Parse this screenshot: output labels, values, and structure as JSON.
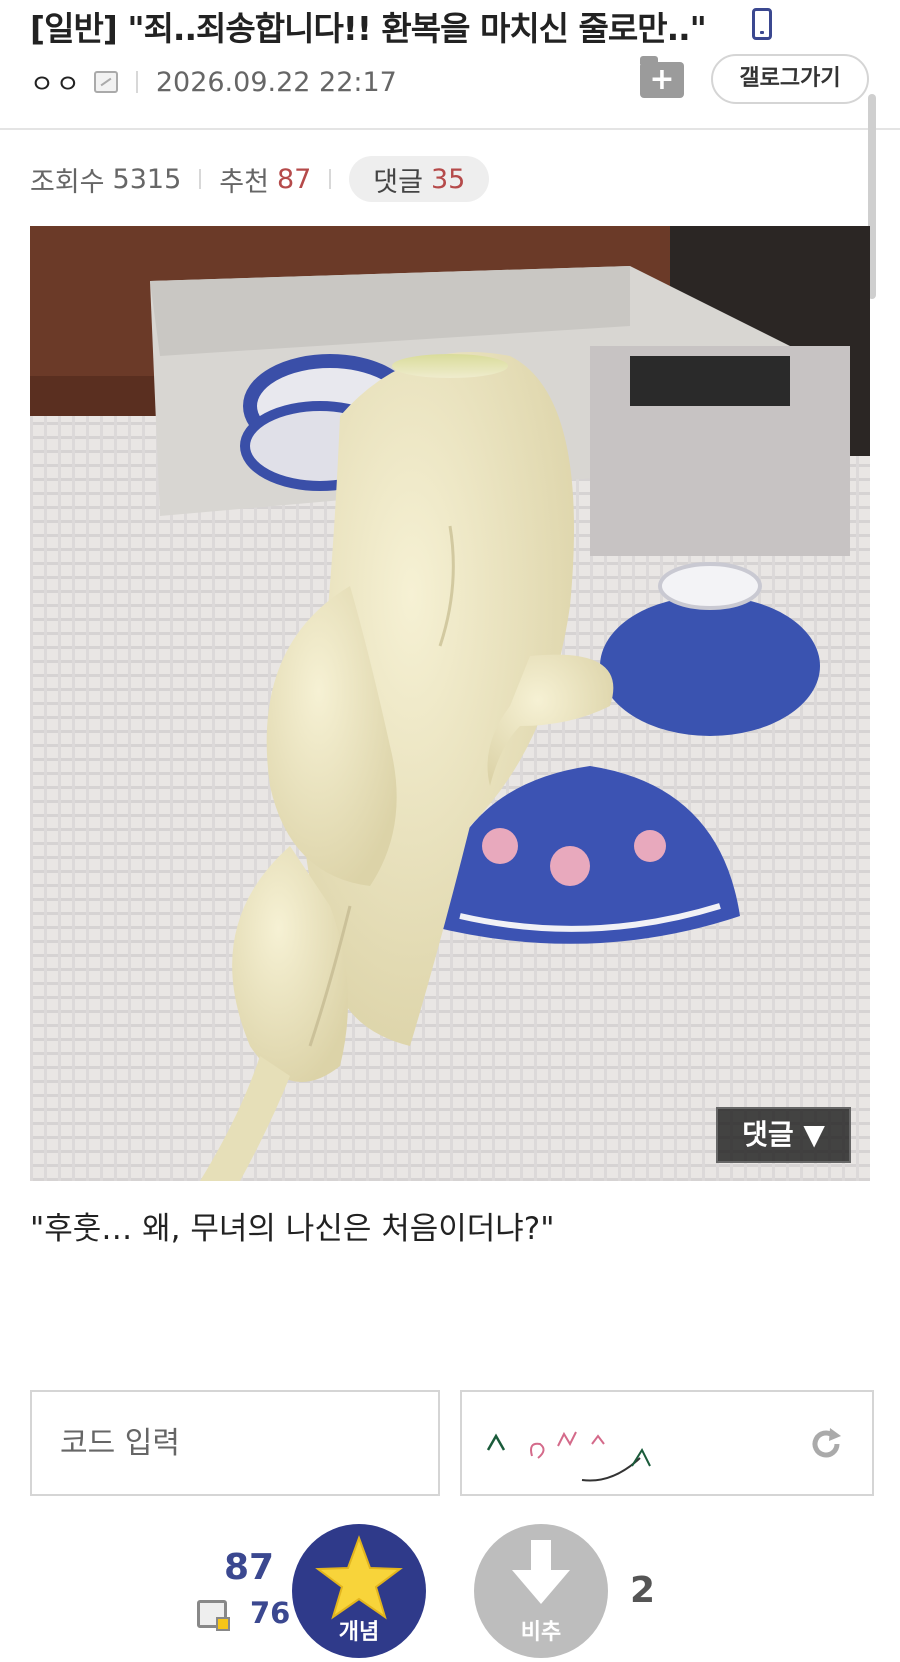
{
  "header": {
    "title": "[일반] \"죄..죄송합니다!! 환복을 마치신 줄로만..\"",
    "nickname": "ㅇㅇ",
    "datetime": "2026.09.22 22:17",
    "gallery_button": "갤로그가기",
    "folder_button": "+"
  },
  "stats": {
    "views_label": "조회수",
    "views": "5315",
    "recommend_label": "추천",
    "recommend": "87",
    "comments_label": "댓글",
    "comments": "35"
  },
  "post": {
    "image_comment_button": "댓글 ▼",
    "caption": "\"후훗… 왜, 무녀의 나신은 처음이더냐?\""
  },
  "captcha": {
    "placeholder": "코드 입력"
  },
  "votes": {
    "up_count": "87",
    "fixed_up_count": "76",
    "up_label": "개념",
    "down_label": "비추",
    "down_count": "2"
  },
  "colors": {
    "brand": "#2f3a8a",
    "count_red": "#b54a4a"
  }
}
